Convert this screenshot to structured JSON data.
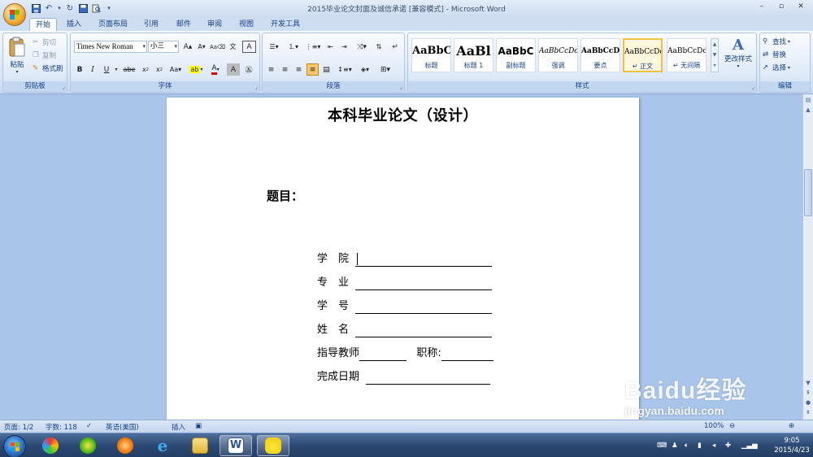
{
  "window": {
    "title": "2015毕业论文封面及诚信承诺 [兼容模式] - Microsoft Word",
    "controls": [
      "–",
      "▫",
      "✕"
    ]
  },
  "tabs": [
    {
      "label": "开始",
      "active": true
    },
    {
      "label": "插入"
    },
    {
      "label": "页面布局"
    },
    {
      "label": "引用"
    },
    {
      "label": "邮件"
    },
    {
      "label": "审阅"
    },
    {
      "label": "视图"
    },
    {
      "label": "开发工具"
    }
  ],
  "clipboard": {
    "paste": "粘贴",
    "cut": "剪切",
    "copy": "复制",
    "format_painter": "格式刷",
    "label": "剪贴板"
  },
  "font": {
    "name": "Times New Roman",
    "size": "小三",
    "label": "字体"
  },
  "paragraph": {
    "label": "段落"
  },
  "styles": {
    "label": "样式",
    "items": [
      {
        "sample": "AaBbC",
        "name": "标题"
      },
      {
        "sample": "AaBl",
        "name": "标题 1"
      },
      {
        "sample": "AaBbC",
        "name": "副标题"
      },
      {
        "sample": "AaBbCcDd",
        "name": "强调"
      },
      {
        "sample": "AaBbCcD",
        "name": "要点"
      },
      {
        "sample": "AaBbCcDd",
        "name": "↵ 正文"
      },
      {
        "sample": "AaBbCcDd",
        "name": "↵ 无间隔"
      }
    ],
    "change": "更改样式"
  },
  "editing": {
    "find": "查找",
    "replace": "替换",
    "select": "选择",
    "label": "编辑"
  },
  "document": {
    "title": "本科毕业论文（设计）",
    "topic_label": "题目：",
    "fields": [
      {
        "label": "学　院"
      },
      {
        "label": "专　业"
      },
      {
        "label": "学　号"
      },
      {
        "label": "姓　名"
      },
      {
        "label": "指导教师",
        "label2": "职称:"
      },
      {
        "label": "完成日期"
      }
    ]
  },
  "status": {
    "page": "页面: 1/2",
    "words": "字数: 118",
    "language": "英语(美国)",
    "mode": "插入",
    "zoom": "100%"
  },
  "taskbar": {
    "time": "9:05",
    "date": "2015/4/23"
  },
  "watermark": {
    "text": "Baidu经验",
    "url": "jingyan.baidu.com"
  }
}
